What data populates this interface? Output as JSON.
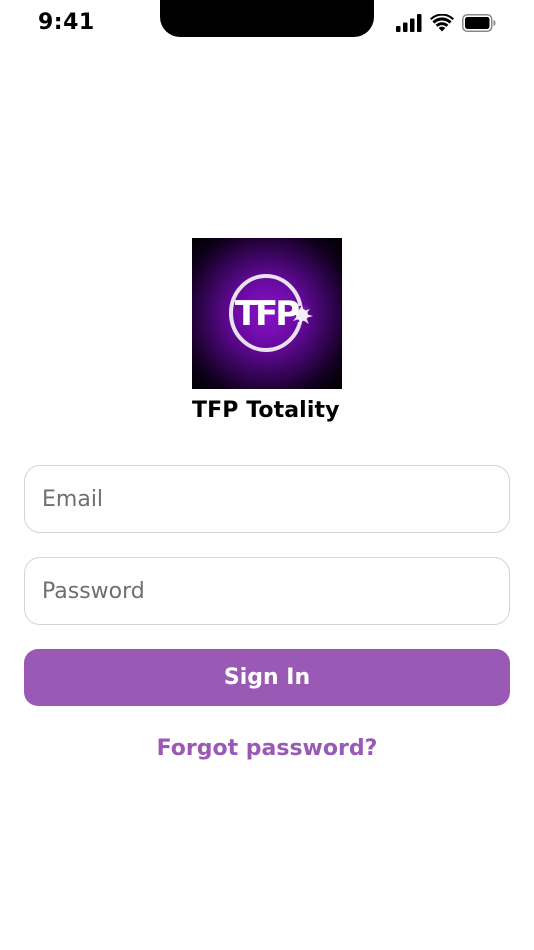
{
  "status_bar": {
    "time": "9:41",
    "icons": [
      "cellular-signal-icon",
      "wifi-icon",
      "battery-icon"
    ]
  },
  "app": {
    "logo_text": "TFP",
    "name": "TFP Totality"
  },
  "form": {
    "email_placeholder": "Email",
    "email_value": "",
    "password_placeholder": "Password",
    "password_value": "",
    "signin_label": "Sign In",
    "forgot_label": "Forgot password?"
  },
  "colors": {
    "accent": "#9b59b6",
    "logo_background": "#6a0aa2",
    "field_border": "#d4d4d4"
  }
}
